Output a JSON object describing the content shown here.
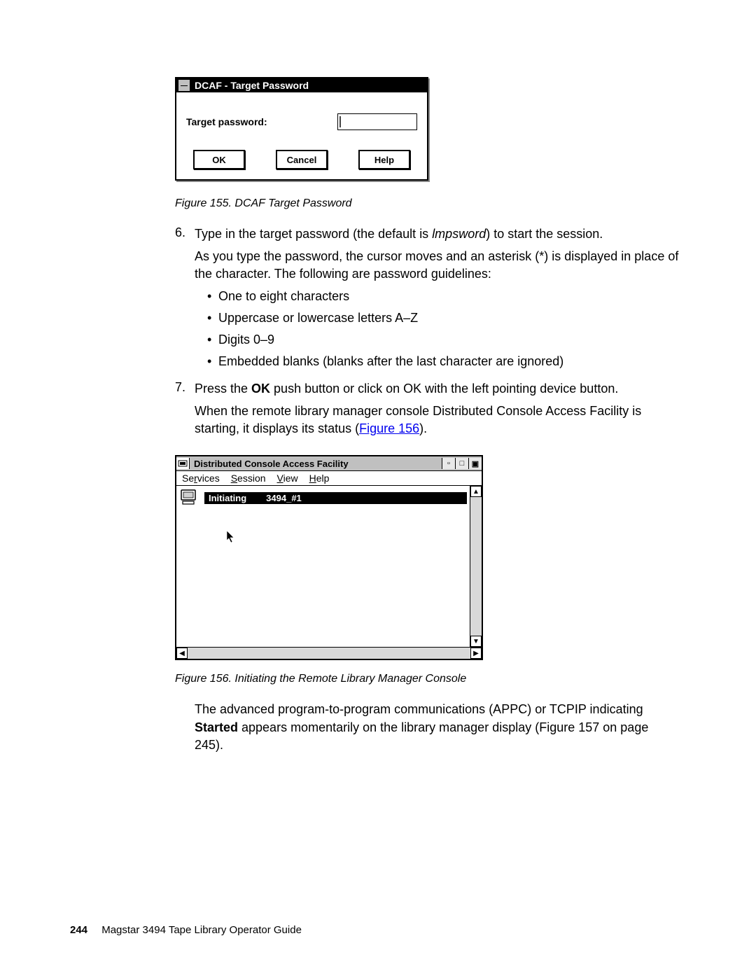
{
  "dialog155": {
    "title": "DCAF - Target Password",
    "label": "Target password:",
    "buttons": {
      "ok": "OK",
      "cancel": "Cancel",
      "help": "Help"
    }
  },
  "fig155_caption": "Figure 155. DCAF Target Password",
  "step6": {
    "num": "6.",
    "p1a": "Type in the target password (the default is ",
    "p1_em": "lmpsword",
    "p1b": ") to start the session.",
    "p2": "As you type the password, the cursor moves and an asterisk (*) is displayed in place of the character. The following are password guidelines:",
    "bullets": [
      "One to eight characters",
      "Uppercase or lowercase letters A–Z",
      "Digits 0–9",
      "Embedded blanks (blanks after the last character are ignored)"
    ]
  },
  "step7": {
    "num": "7.",
    "p1a": "Press the ",
    "p1_b": "OK",
    "p1b": " push button or click on OK with the left pointing device button.",
    "p2a": "When the remote library manager console Distributed Console Access Facility is starting, it displays its status (",
    "p2_link": "Figure 156",
    "p2b": ")."
  },
  "win156": {
    "title": "Distributed Console Access Facility",
    "menu": {
      "m1a": "Se",
      "m1u": "r",
      "m1b": "vices",
      "m2u": "S",
      "m2b": "ession",
      "m3u": "V",
      "m3b": "iew",
      "m4u": "H",
      "m4b": "elp"
    },
    "status": {
      "state": "Initiating",
      "target": "3494_#1"
    }
  },
  "fig156_caption": "Figure 156. Initiating the Remote Library Manager Console",
  "para_after": {
    "a": "The advanced program-to-program communications (APPC) or TCPIP indicating ",
    "b": "Started",
    "c": " appears momentarily on the library manager display (Figure 157 on page 245)."
  },
  "footer": {
    "page": "244",
    "book": "Magstar 3494 Tape Library Operator Guide"
  }
}
